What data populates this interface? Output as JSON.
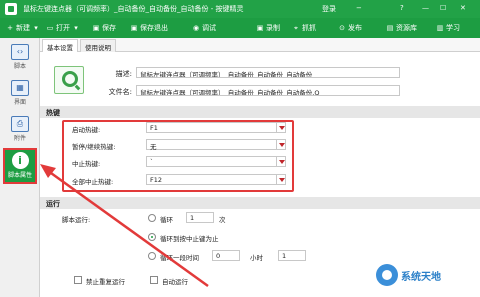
{
  "window": {
    "title": "鼠标左键连点器（可调频率）_自动备份_自动备份_自动备份 - 按键精灵",
    "login": "登录",
    "restore": "帮"
  },
  "toolbar": {
    "new": "新建",
    "open": "打开",
    "save": "保存",
    "save_exit": "保存退出",
    "debug": "调试",
    "record": "录制",
    "capture": "抓抓",
    "publish": "发布",
    "resource": "资源库",
    "learn": "学习"
  },
  "sidebar": {
    "items": [
      {
        "label": "脚本",
        "icon": "code-icon"
      },
      {
        "label": "界面",
        "icon": "layout-icon"
      },
      {
        "label": "附件",
        "icon": "attachment-icon"
      },
      {
        "label": "脚本属性",
        "icon": "info-icon"
      }
    ]
  },
  "tabs": {
    "basic": "基本设置",
    "help": "使用说明"
  },
  "form": {
    "desc_label": "描述:",
    "desc_value": "鼠标左键连点器（可调频率）_自动备份_自动备份_自动备份",
    "file_label": "文件名:",
    "file_value": "鼠标左键连点器（可调频率）_自动备份_自动备份_自动备份.Q"
  },
  "hotkeys": {
    "section_title": "热键",
    "rows": [
      {
        "label": "启动热键:",
        "value": "F1"
      },
      {
        "label": "暂停/继续热键:",
        "value": "无"
      },
      {
        "label": "中止热键:",
        "value": "`"
      },
      {
        "label": "全部中止热键:",
        "value": "F12"
      }
    ]
  },
  "run": {
    "section_title": "运行",
    "mode_label": "脚本运行:",
    "loop_label": "循环",
    "loop_count": "1",
    "loop_unit": "次",
    "until_stop_label": "循环到按中止键为止",
    "loop_time_label": "循环一段时间",
    "hours_value": "0",
    "hours_unit": "小时",
    "minutes_value": "1",
    "no_repeat_label": "禁止重复运行",
    "auto_run_label": "自动运行"
  },
  "watermark": {
    "text": "系统天地"
  },
  "colors": {
    "brand_green": "#1d9d42",
    "highlight_red": "#e23a3a"
  }
}
